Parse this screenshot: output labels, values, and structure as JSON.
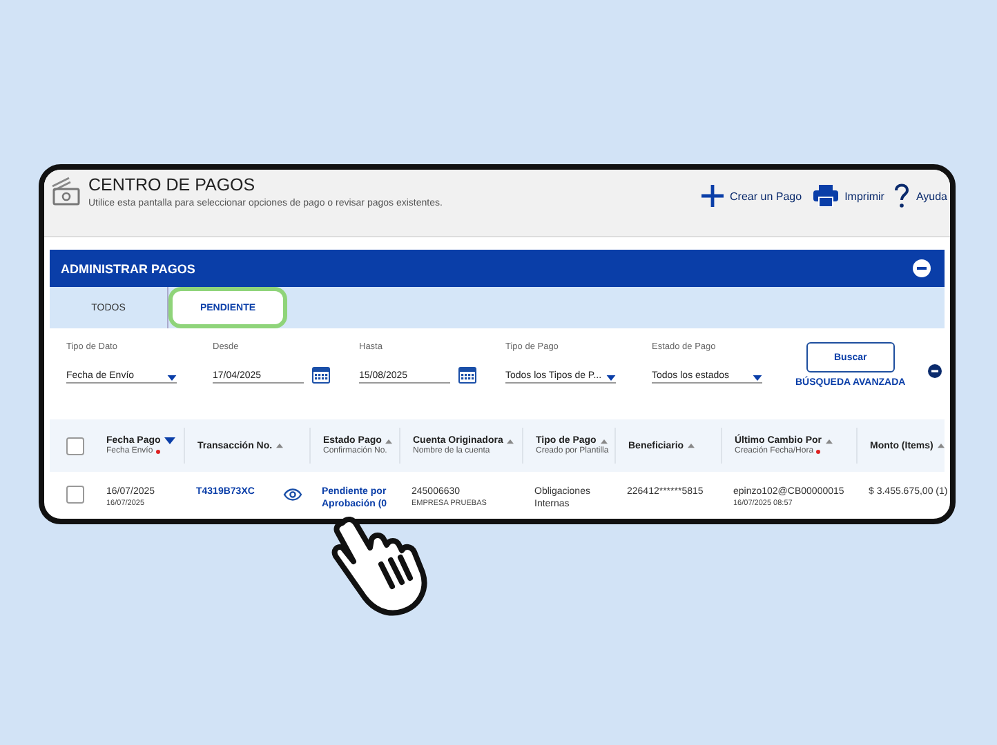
{
  "header": {
    "title": "CENTRO DE PAGOS",
    "subtitle": "Utilice esta pantalla para seleccionar opciones de pago o revisar pagos existentes.",
    "actions": [
      {
        "kind": "create",
        "label": "Crear un Pago"
      },
      {
        "kind": "print",
        "label": "Imprimir"
      },
      {
        "kind": "help",
        "label": "Ayuda"
      }
    ]
  },
  "panel": {
    "title": "ADMINISTRAR PAGOS"
  },
  "tabs": [
    {
      "label": "TODOS",
      "selected": false
    },
    {
      "label": "PENDIENTE",
      "selected": true
    }
  ],
  "filters": [
    {
      "kind": "select",
      "label": "Tipo de Dato",
      "value": "Fecha de Envío"
    },
    {
      "kind": "date",
      "label": "Desde",
      "value": "17/04/2025"
    },
    {
      "kind": "date",
      "label": "Hasta",
      "value": "15/08/2025"
    },
    {
      "kind": "select",
      "label": "Tipo de Pago",
      "value": "Todos los Tipos de P..."
    },
    {
      "kind": "select",
      "label": "Estado de Pago",
      "value": "Todos los estados"
    }
  ],
  "search_button": "Buscar",
  "advanced_search": "BÚSQUEDA AVANZADA",
  "table": {
    "select_all_checked": false,
    "columns": [
      {
        "title": "Fecha Pago",
        "subtitle": "Fecha Envío",
        "sorted": true,
        "required": true
      },
      {
        "title": "Transacción No.",
        "sorted": false,
        "required": false
      },
      {
        "title": "Estado Pago",
        "subtitle": "Confirmación No.",
        "sorted": false,
        "required": false
      },
      {
        "title": "Cuenta Originadora",
        "subtitle": "Nombre de la cuenta",
        "sorted": false,
        "required": false
      },
      {
        "title": "Tipo de Pago",
        "subtitle": "Creado por Plantilla",
        "sorted": false,
        "required": false
      },
      {
        "title": "Beneficiario",
        "sorted": false,
        "required": false
      },
      {
        "title": "Último Cambio Por",
        "subtitle": "Creación Fecha/Hora",
        "sorted": false,
        "required": true
      },
      {
        "title": "Monto (Items)",
        "sorted": false,
        "required": false
      }
    ],
    "rows": [
      {
        "checked": false,
        "cells": [
          {
            "kind": "plain",
            "text": "16/07/2025",
            "sub": "16/07/2025"
          },
          {
            "kind": "link-eye",
            "text": "T4319B73XC"
          },
          {
            "kind": "link",
            "text": "Pendiente por Aprobación (0"
          },
          {
            "kind": "plain",
            "text": "245006630",
            "sub": "EMPRESA PRUEBAS"
          },
          {
            "kind": "plain",
            "text": "Obligaciones Internas"
          },
          {
            "kind": "plain",
            "text": "226412******5815"
          },
          {
            "kind": "plain",
            "text": "epinzo102@CB00000015",
            "sub": "16/07/2025 08:57"
          },
          {
            "kind": "plain",
            "text": "$ 3.455.675,00 (1)"
          }
        ]
      }
    ]
  }
}
